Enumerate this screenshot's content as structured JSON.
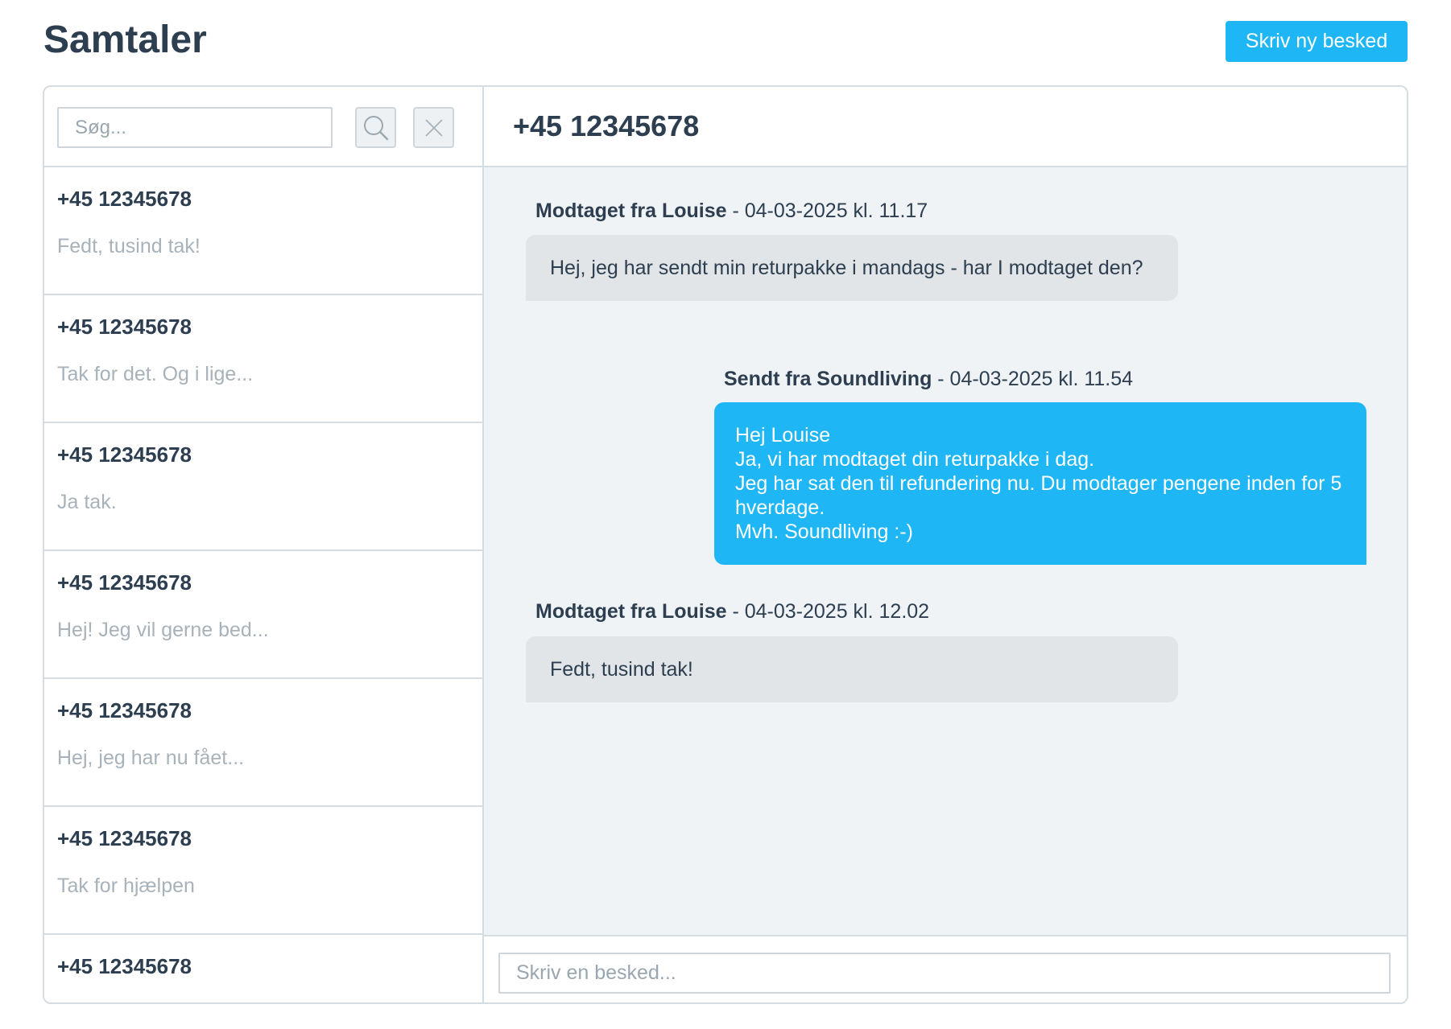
{
  "header": {
    "title": "Samtaler",
    "new_message_label": "Skriv ny besked"
  },
  "search": {
    "placeholder": "Søg...",
    "search_icon": "search-icon",
    "clear_icon": "close-icon"
  },
  "conversations": [
    {
      "number": "+45 12345678",
      "preview": "Fedt, tusind tak!"
    },
    {
      "number": "+45 12345678",
      "preview": "Tak for det. Og i lige..."
    },
    {
      "number": "+45 12345678",
      "preview": "Ja tak."
    },
    {
      "number": "+45 12345678",
      "preview": "Hej! Jeg vil gerne bed..."
    },
    {
      "number": "+45 12345678",
      "preview": "Hej, jeg har nu fået..."
    },
    {
      "number": "+45 12345678",
      "preview": "Tak for hjælpen"
    },
    {
      "number": "+45 12345678",
      "preview": ""
    }
  ],
  "chat": {
    "title": "+45 12345678",
    "messages": [
      {
        "direction": "in",
        "sender": "Modtaget fra Louise",
        "timestamp": " - 04-03-2025 kl. 11.17",
        "text": "Hej, jeg har sendt min returpakke i mandags - har I modtaget den?"
      },
      {
        "direction": "out",
        "sender": "Sendt fra Soundliving",
        "timestamp": " - 04-03-2025 kl. 11.54",
        "text": "Hej Louise\nJa, vi har modtaget din returpakke i dag.\nJeg har sat den til refundering nu. Du modtager pengene inden for 5 hverdage.\nMvh. Soundliving :-)"
      },
      {
        "direction": "in",
        "sender": "Modtaget fra Louise",
        "timestamp": " - 04-03-2025 kl. 12.02",
        "text": "Fedt, tusind tak!"
      }
    ],
    "composer_placeholder": "Skriv en besked..."
  },
  "colors": {
    "accent": "#1fb6f5",
    "text": "#2c3e50",
    "muted": "#a7b2ba",
    "incoming_bubble": "#e1e5e8",
    "chat_background": "#f0f3f6"
  }
}
